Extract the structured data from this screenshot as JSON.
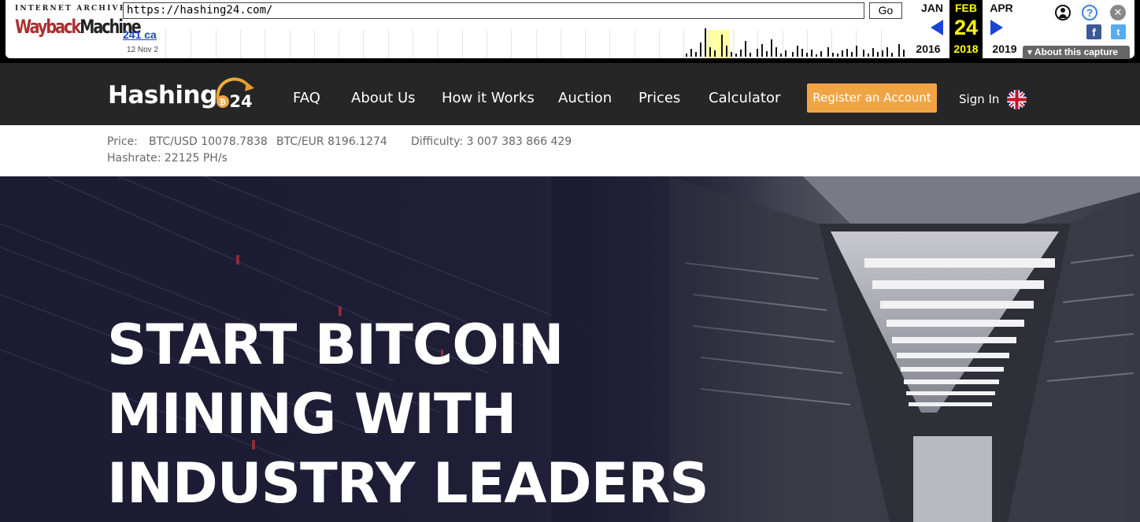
{
  "wayback": {
    "logo_top": "INTERNET ARCHIVE",
    "logo_wayback": "Wayback",
    "logo_machine": "Machine",
    "url": "https://hashing24.com/",
    "go_label": "Go",
    "captures_label": "241 ca",
    "date_range": "12 Nov 2",
    "prev_month": "JAN",
    "cur_month": "FEB",
    "next_month": "APR",
    "cur_day": "24",
    "prev_year": "2016",
    "cur_year": "2018",
    "next_year": "2019",
    "about_label": "About this capture",
    "help_glyph": "?",
    "close_glyph": "✕",
    "fb_glyph": "f",
    "tw_glyph": "t"
  },
  "nav": {
    "brand": "Hashing",
    "brand_number": "24",
    "links": [
      "FAQ",
      "About Us",
      "How it Works",
      "Auction",
      "Prices",
      "Calculator"
    ],
    "register": "Register an Account",
    "signin": "Sign In"
  },
  "prices": {
    "price_label": "Price:",
    "btc_usd": "BTC/USD 10078.7838",
    "btc_eur": "BTC/EUR 8196.1274",
    "difficulty": "Difficulty: 3 007 383 866 429",
    "hashrate": "Hashrate: 22125 PH/s"
  },
  "hero": {
    "line1": "START BITCOIN",
    "line2": "MINING WITH",
    "line3": "INDUSTRY LEADERS"
  },
  "colors": {
    "nav_bg": "#262626",
    "accent": "#f0a545",
    "wayback_blue": "#1a44d8",
    "wayback_yellow": "#ffff00"
  }
}
